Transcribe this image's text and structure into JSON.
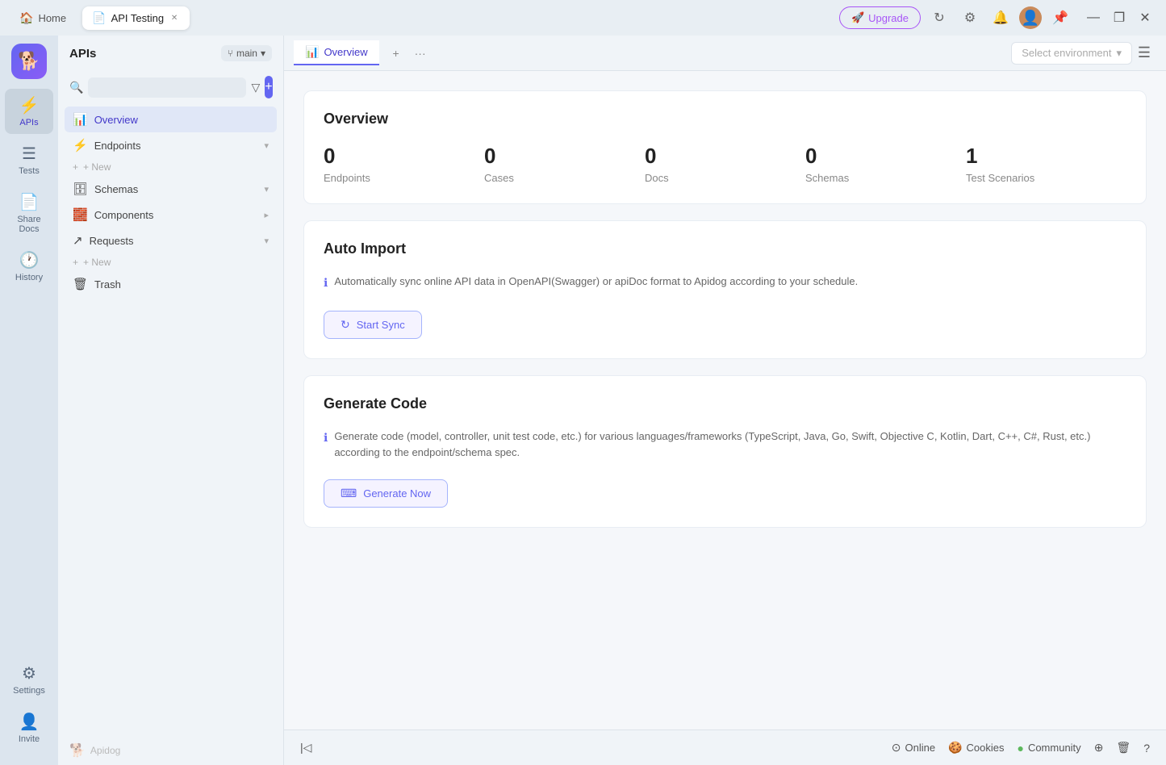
{
  "titlebar": {
    "home_tab": "Home",
    "active_tab": "API Testing",
    "close_label": "×",
    "upgrade_label": "Upgrade",
    "window_min": "—",
    "window_max": "❐",
    "window_close": "✕"
  },
  "sidebar": {
    "logo_icon": "🔷",
    "items": [
      {
        "id": "apis",
        "label": "APIs",
        "icon": "🔷",
        "active": true
      },
      {
        "id": "tests",
        "label": "Tests",
        "icon": "📋",
        "active": false
      },
      {
        "id": "share-docs",
        "label": "Share Docs",
        "icon": "📄",
        "active": false
      },
      {
        "id": "history",
        "label": "History",
        "icon": "🕐",
        "active": false
      },
      {
        "id": "settings",
        "label": "Settings",
        "icon": "⚙️",
        "active": false
      }
    ],
    "bottom_items": [
      {
        "id": "invite",
        "label": "Invite",
        "icon": "👤+",
        "active": false
      }
    ]
  },
  "left_panel": {
    "title": "APIs",
    "branch": "main",
    "search_placeholder": "",
    "tree_items": [
      {
        "id": "overview",
        "label": "Overview",
        "icon": "📊",
        "active": true
      },
      {
        "id": "endpoints",
        "label": "Endpoints",
        "icon": "⚡",
        "active": false,
        "has_arrow": true
      },
      {
        "id": "schemas",
        "label": "Schemas",
        "icon": "🗄",
        "active": false,
        "has_arrow": true
      },
      {
        "id": "components",
        "label": "Components",
        "icon": "🧱",
        "active": false,
        "has_arrow": true
      },
      {
        "id": "requests",
        "label": "Requests",
        "icon": "↗",
        "active": false,
        "has_arrow": true
      },
      {
        "id": "trash",
        "label": "Trash",
        "icon": "🗑",
        "active": false
      }
    ],
    "new_label": "+ New",
    "footer_logo": "Apidog"
  },
  "content_header": {
    "tab_icon": "📊",
    "tab_label": "Overview",
    "add_tab_label": "+",
    "more_label": "···",
    "env_placeholder": "Select environment",
    "menu_label": "☰"
  },
  "overview": {
    "title": "Overview",
    "stats": [
      {
        "label": "Endpoints",
        "value": "0"
      },
      {
        "label": "Cases",
        "value": "0"
      },
      {
        "label": "Docs",
        "value": "0"
      },
      {
        "label": "Schemas",
        "value": "0"
      },
      {
        "label": "Test Scenarios",
        "value": "1"
      }
    ]
  },
  "auto_import": {
    "title": "Auto Import",
    "description": "Automatically sync online API data in OpenAPI(Swagger) or apiDoc format to Apidog according to your schedule.",
    "button_label": "Start Sync",
    "button_icon": "↻"
  },
  "generate_code": {
    "title": "Generate Code",
    "description": "Generate code (model, controller, unit test code, etc.) for various languages/frameworks (TypeScript, Java, Go, Swift, Objective C, Kotlin, Dart, C++, C#, Rust, etc.) according to the endpoint/schema spec.",
    "button_label": "Generate Now",
    "button_icon": "⌨"
  },
  "footer": {
    "online_label": "Online",
    "cookies_label": "Cookies",
    "community_label": "Community",
    "icons_right": [
      "⊕",
      "🗑",
      "?"
    ]
  },
  "colors": {
    "accent": "#6366f1",
    "accent_light": "#f5f3ff",
    "accent_border": "#a5b4fc",
    "sidebar_bg": "#dce5ee",
    "panel_bg": "#f0f4f8"
  }
}
